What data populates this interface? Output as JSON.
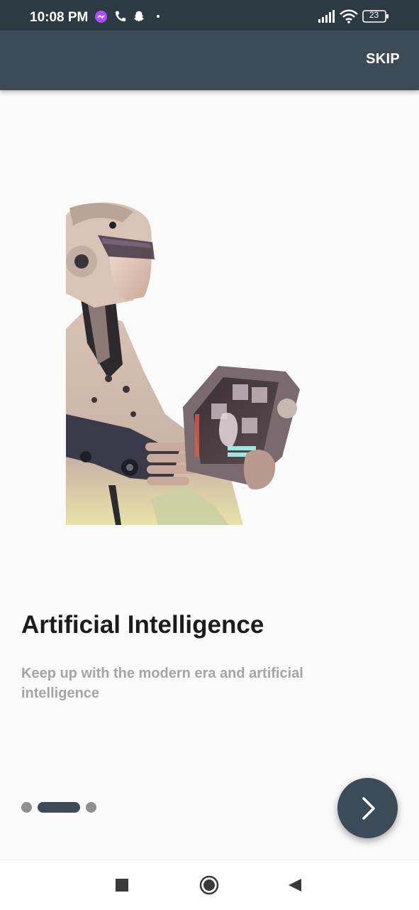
{
  "status_bar": {
    "time": "10:08 PM",
    "battery": "23",
    "icons": [
      "messenger-icon",
      "phone-icon",
      "snapchat-icon",
      "dot-icon",
      "signal-icon",
      "wifi-icon",
      "battery-icon"
    ]
  },
  "app_bar": {
    "skip_label": "SKIP"
  },
  "hero": {
    "image": "robot-holding-tablet-illustration"
  },
  "content": {
    "title": "Artificial Intelligence",
    "subtitle": "Keep up with the modern era and artificial intelligence"
  },
  "pager": {
    "page_count": 3,
    "active_index": 1
  },
  "next_button": {
    "icon": "chevron-right-icon"
  },
  "nav_bar": {
    "icons": [
      "recents-square-icon",
      "home-circle-icon",
      "back-triangle-icon"
    ]
  },
  "colors": {
    "status_bar": "#2c3a44",
    "app_bar": "#3b4b57",
    "background": "#fafafa",
    "title": "#1c1c1c",
    "subtitle": "#a5a5a5",
    "dot_inactive": "#8f8f8f",
    "dot_active": "#3b4b57"
  }
}
